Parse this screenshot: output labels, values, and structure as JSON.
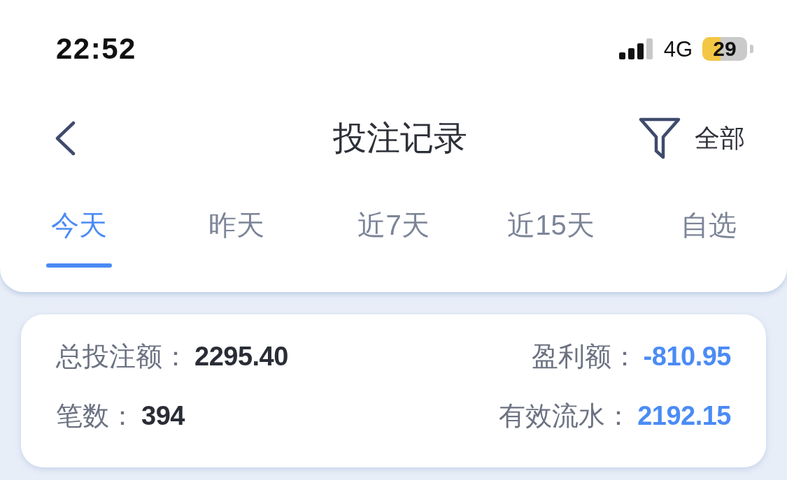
{
  "status_bar": {
    "time": "22:52",
    "network": "4G",
    "battery": "29"
  },
  "header": {
    "title": "投注记录",
    "filter_label": "全部"
  },
  "tabs": [
    {
      "label": "今天",
      "selected": true
    },
    {
      "label": "昨天",
      "selected": false
    },
    {
      "label": "近7天",
      "selected": false
    },
    {
      "label": "近15天",
      "selected": false
    },
    {
      "label": "自选",
      "selected": false
    }
  ],
  "summary": {
    "rows": [
      {
        "left": {
          "label": "总投注额：",
          "value": "2295.40"
        },
        "right": {
          "label": "盈利额：",
          "value": "-810.95"
        }
      },
      {
        "left": {
          "label": "笔数：",
          "value": "394"
        },
        "right": {
          "label": "有效流水：",
          "value": "2192.15"
        }
      }
    ]
  }
}
